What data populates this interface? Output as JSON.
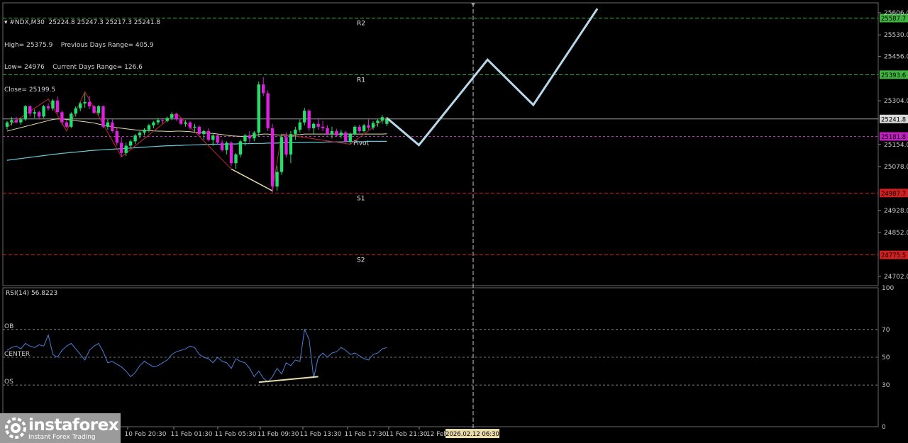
{
  "header": {
    "symbol_line": "#NDX,M30  25224.8 25247.3 25217.3 25241.8",
    "high": "High= 25375.9",
    "prev_range": "Previous Days Range= 405.9",
    "low": "Low= 24976",
    "cur_range": "Current Days Range= 126.6",
    "close": "Close= 25199.5"
  },
  "rsi_title": "RSI(14) 56.8223",
  "logo": {
    "name": "instaforex",
    "tagline": "Instant Forex Trading"
  },
  "colors": {
    "bull": "#22e06b",
    "bear": "#e020e0",
    "level_green": "#3fb53f",
    "level_red": "#d02020",
    "price_tag": "#3aa83a",
    "price_line": "#b0b0b0",
    "ma_fast": "#e8dcaa",
    "ma_slow": "#6ac8d8",
    "forecast": "#b8d8ea",
    "rsi_line": "#4a7fd6",
    "wave": "#c02a2a"
  },
  "chart_data": {
    "type": "candlestick",
    "symbol": "#NDX",
    "timeframe": "M30",
    "ylim": [
      24670,
      25640
    ],
    "y_ticks": [
      25606.0,
      25530.0,
      25456.0,
      25304.0,
      25154.0,
      25078.0,
      24928.0,
      24852.0,
      24702.0
    ],
    "x_ticks": [
      "10 Feb 20:30",
      "11 Feb 01:30",
      "11 Feb 05:30",
      "11 Feb 09:30",
      "11 Feb 13:30",
      "11 Feb 17:30",
      "11 Feb 21:30",
      "12 Feb"
    ],
    "x_marker": "2026.02.12 06:30",
    "last_price": 25241.8,
    "levels": [
      {
        "name": "R2",
        "value": 25587.7,
        "kind": "resistance"
      },
      {
        "name": "R1",
        "value": 25393.6,
        "kind": "resistance"
      },
      {
        "name": "Pivot",
        "value": 25181.8,
        "kind": "pivot"
      },
      {
        "name": "S1",
        "value": 24987.7,
        "kind": "support"
      },
      {
        "name": "S2",
        "value": 24775.5,
        "kind": "support"
      }
    ],
    "ohlc": [
      [
        25215,
        25235,
        25205,
        25230
      ],
      [
        25230,
        25248,
        25220,
        25238
      ],
      [
        25238,
        25250,
        25226,
        25230
      ],
      [
        25230,
        25245,
        25222,
        25240
      ],
      [
        25240,
        25290,
        25235,
        25285
      ],
      [
        25285,
        25288,
        25250,
        25260
      ],
      [
        25260,
        25275,
        25245,
        25265
      ],
      [
        25265,
        25270,
        25240,
        25250
      ],
      [
        25250,
        25290,
        25245,
        25285
      ],
      [
        25285,
        25295,
        25270,
        25278
      ],
      [
        25278,
        25310,
        25270,
        25305
      ],
      [
        25305,
        25320,
        25260,
        25265
      ],
      [
        25265,
        25270,
        25220,
        25230
      ],
      [
        25230,
        25240,
        25210,
        25215
      ],
      [
        25215,
        25265,
        25210,
        25260
      ],
      [
        25260,
        25285,
        25250,
        25278
      ],
      [
        25278,
        25300,
        25268,
        25295
      ],
      [
        25295,
        25330,
        25280,
        25300
      ],
      [
        25300,
        25320,
        25275,
        25285
      ],
      [
        25285,
        25290,
        25260,
        25262
      ],
      [
        25262,
        25290,
        25255,
        25285
      ],
      [
        25285,
        25288,
        25210,
        25215
      ],
      [
        25215,
        25240,
        25205,
        25230
      ],
      [
        25230,
        25240,
        25195,
        25200
      ],
      [
        25200,
        25210,
        25150,
        25160
      ],
      [
        25160,
        25180,
        25110,
        25125
      ],
      [
        25125,
        25160,
        25115,
        25150
      ],
      [
        25150,
        25170,
        25140,
        25165
      ],
      [
        25165,
        25190,
        25155,
        25185
      ],
      [
        25185,
        25200,
        25175,
        25195
      ],
      [
        25195,
        25210,
        25185,
        25205
      ],
      [
        25205,
        25225,
        25195,
        25220
      ],
      [
        25220,
        25235,
        25210,
        25230
      ],
      [
        25230,
        25245,
        25222,
        25238
      ],
      [
        25238,
        25245,
        25225,
        25235
      ],
      [
        25235,
        25250,
        25230,
        25245
      ],
      [
        25245,
        25265,
        25238,
        25258
      ],
      [
        25258,
        25262,
        25235,
        25240
      ],
      [
        25240,
        25245,
        25220,
        25225
      ],
      [
        25225,
        25238,
        25215,
        25230
      ],
      [
        25230,
        25235,
        25205,
        25212
      ],
      [
        25212,
        25225,
        25195,
        25215
      ],
      [
        25215,
        25220,
        25185,
        25190
      ],
      [
        25190,
        25205,
        25170,
        25200
      ],
      [
        25200,
        25210,
        25165,
        25170
      ],
      [
        25170,
        25190,
        25150,
        25185
      ],
      [
        25185,
        25190,
        25155,
        25160
      ],
      [
        25160,
        25170,
        25130,
        25135
      ],
      [
        25135,
        25165,
        25120,
        25160
      ],
      [
        25160,
        25165,
        25080,
        25090
      ],
      [
        25090,
        25125,
        25070,
        25120
      ],
      [
        25120,
        25170,
        25110,
        25165
      ],
      [
        25165,
        25190,
        25150,
        25185
      ],
      [
        25185,
        25200,
        25160,
        25175
      ],
      [
        25175,
        25200,
        25165,
        25195
      ],
      [
        25195,
        25370,
        25180,
        25360
      ],
      [
        25360,
        25385,
        25320,
        25330
      ],
      [
        25330,
        25340,
        25200,
        25210
      ],
      [
        25210,
        25225,
        24990,
        25010
      ],
      [
        25010,
        25080,
        24995,
        25060
      ],
      [
        25060,
        25190,
        25050,
        25180
      ],
      [
        25180,
        25195,
        25110,
        25120
      ],
      [
        25120,
        25200,
        25090,
        25190
      ],
      [
        25190,
        25215,
        25170,
        25205
      ],
      [
        25205,
        25240,
        25195,
        25230
      ],
      [
        25230,
        25280,
        25220,
        25270
      ],
      [
        25270,
        25275,
        25200,
        25210
      ],
      [
        25210,
        25230,
        25190,
        25225
      ],
      [
        25225,
        25245,
        25205,
        25215
      ],
      [
        25215,
        25235,
        25200,
        25210
      ],
      [
        25210,
        25220,
        25185,
        25190
      ],
      [
        25190,
        25215,
        25175,
        25200
      ],
      [
        25200,
        25208,
        25180,
        25185
      ],
      [
        25185,
        25205,
        25175,
        25195
      ],
      [
        25195,
        25200,
        25160,
        25165
      ],
      [
        25165,
        25195,
        25155,
        25190
      ],
      [
        25190,
        25220,
        25185,
        25215
      ],
      [
        25215,
        25222,
        25195,
        25200
      ],
      [
        25200,
        25225,
        25195,
        25220
      ],
      [
        25220,
        25240,
        25205,
        25212
      ],
      [
        25212,
        25235,
        25205,
        25228
      ],
      [
        25228,
        25242,
        25215,
        25236
      ],
      [
        25236,
        25255,
        25225,
        25248
      ],
      [
        25224.8,
        25247.3,
        25217.3,
        25241.8
      ]
    ],
    "ma_fast": [
      25200,
      25204,
      25208,
      25212,
      25216,
      25220,
      25224,
      25228,
      25232,
      25236,
      25240,
      25242,
      25242,
      25240,
      25238,
      25236,
      25234,
      25232,
      25230,
      25228,
      25224,
      25221,
      25218,
      25215,
      25212,
      25210,
      25208,
      25206,
      25204,
      25203,
      25202,
      25202,
      25201,
      25200,
      25200,
      25199,
      25199,
      25200,
      25200,
      25199,
      25198,
      25196,
      25195,
      25194,
      25193,
      25192,
      25190,
      25188,
      25186,
      25184,
      25183,
      25182,
      25182,
      25183,
      25185,
      25188,
      25190,
      25190,
      25188,
      25187,
      25186,
      25186,
      25186,
      25187,
      25188,
      25190,
      25190,
      25190,
      25190,
      25190,
      25190,
      25190,
      25190,
      25190,
      25190,
      25190,
      25190,
      25190,
      25190,
      25190,
      25190,
      25190,
      25190,
      25191
    ],
    "ma_slow": [
      25100,
      25102,
      25104,
      25106,
      25108,
      25110,
      25112,
      25114,
      25116,
      25118,
      25120,
      25122,
      25124,
      25125,
      25127,
      25128,
      25130,
      25131,
      25133,
      25134,
      25135,
      25136,
      25137,
      25138,
      25139,
      25140,
      25141,
      25142,
      25143,
      25144,
      25145,
      25146,
      25147,
      25148,
      25149,
      25150,
      25150,
      25151,
      25151,
      25152,
      25152,
      25153,
      25153,
      25154,
      25154,
      25155,
      25155,
      25155,
      25156,
      25156,
      25156,
      25157,
      25157,
      25157,
      25158,
      25158,
      25158,
      25159,
      25159,
      25159,
      25160,
      25160,
      25160,
      25161,
      25161,
      25161,
      25162,
      25162,
      25162,
      25162,
      25163,
      25163,
      25163,
      25163,
      25164,
      25164,
      25164,
      25164,
      25164,
      25165,
      25165,
      25165,
      25165,
      25165
    ],
    "zigzag": [
      [
        0,
        25215
      ],
      [
        9,
        25310
      ],
      [
        13,
        25200
      ],
      [
        17,
        25335
      ],
      [
        25,
        25112
      ],
      [
        37,
        25262
      ],
      [
        49,
        25070
      ],
      [
        58,
        24995
      ],
      [
        60,
        25190
      ],
      [
        75,
        25155
      ],
      [
        83,
        25248
      ]
    ],
    "trend_line": [
      [
        49,
        25070
      ],
      [
        58,
        24995
      ]
    ],
    "forecast": [
      [
        83,
        25245
      ],
      [
        90,
        25152
      ],
      [
        105,
        25445
      ],
      [
        115,
        25290
      ],
      [
        129,
        25620
      ]
    ],
    "rsi": {
      "ylim": [
        0,
        100
      ],
      "y_ticks": [
        100,
        70,
        50,
        30,
        0
      ],
      "levels": [
        {
          "name": "OB",
          "value": 70
        },
        {
          "name": "CENTER",
          "value": 50
        },
        {
          "name": "OS",
          "value": 30
        }
      ],
      "values": [
        55,
        57,
        58,
        56,
        60,
        58,
        57,
        59,
        58,
        66,
        52,
        50,
        55,
        58,
        60,
        56,
        52,
        48,
        55,
        58,
        60,
        54,
        46,
        47,
        45,
        43,
        40,
        36,
        39,
        44,
        47,
        45,
        43,
        44,
        46,
        48,
        52,
        54,
        55,
        56,
        58,
        57,
        52,
        50,
        49,
        46,
        50,
        47,
        46,
        42,
        49,
        47,
        46,
        42,
        36,
        40,
        35,
        32,
        36,
        42,
        38,
        46,
        44,
        48,
        47,
        70,
        63,
        35,
        50,
        53,
        50,
        53,
        54,
        57,
        55,
        52,
        53,
        51,
        49,
        48,
        52,
        53,
        56,
        57
      ],
      "trend": [
        [
          55,
          32
        ],
        [
          68,
          36
        ]
      ]
    }
  }
}
